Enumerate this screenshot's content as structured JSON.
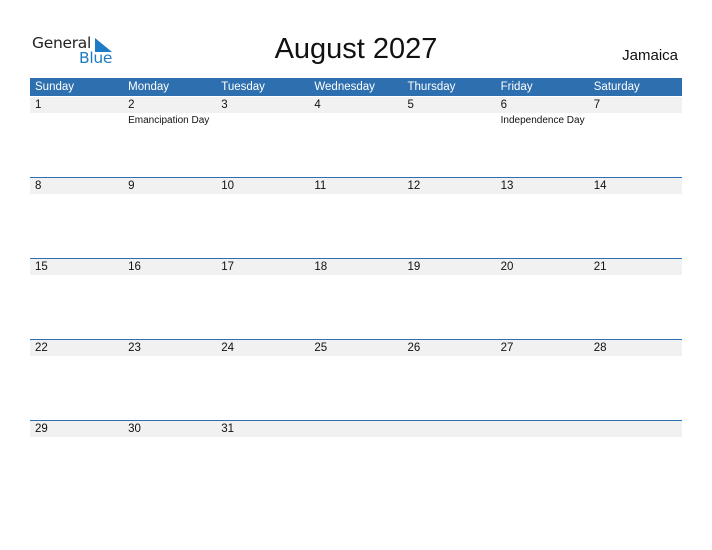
{
  "logo": {
    "word1": "General",
    "word2": "Blue",
    "accent_color": "#1f7bc4"
  },
  "header": {
    "title": "August 2027",
    "country": "Jamaica"
  },
  "calendar": {
    "header_color": "#2e6fb0",
    "weekdays": [
      "Sunday",
      "Monday",
      "Tuesday",
      "Wednesday",
      "Thursday",
      "Friday",
      "Saturday"
    ],
    "weeks": [
      {
        "days": [
          "1",
          "2",
          "3",
          "4",
          "5",
          "6",
          "7"
        ],
        "events": [
          "",
          "Emancipation Day",
          "",
          "",
          "",
          "Independence Day",
          ""
        ]
      },
      {
        "days": [
          "8",
          "9",
          "10",
          "11",
          "12",
          "13",
          "14"
        ],
        "events": [
          "",
          "",
          "",
          "",
          "",
          "",
          ""
        ]
      },
      {
        "days": [
          "15",
          "16",
          "17",
          "18",
          "19",
          "20",
          "21"
        ],
        "events": [
          "",
          "",
          "",
          "",
          "",
          "",
          ""
        ]
      },
      {
        "days": [
          "22",
          "23",
          "24",
          "25",
          "26",
          "27",
          "28"
        ],
        "events": [
          "",
          "",
          "",
          "",
          "",
          "",
          ""
        ]
      },
      {
        "days": [
          "29",
          "30",
          "31",
          "",
          "",
          "",
          ""
        ],
        "events": [
          "",
          "",
          "",
          "",
          "",
          "",
          ""
        ]
      }
    ]
  }
}
